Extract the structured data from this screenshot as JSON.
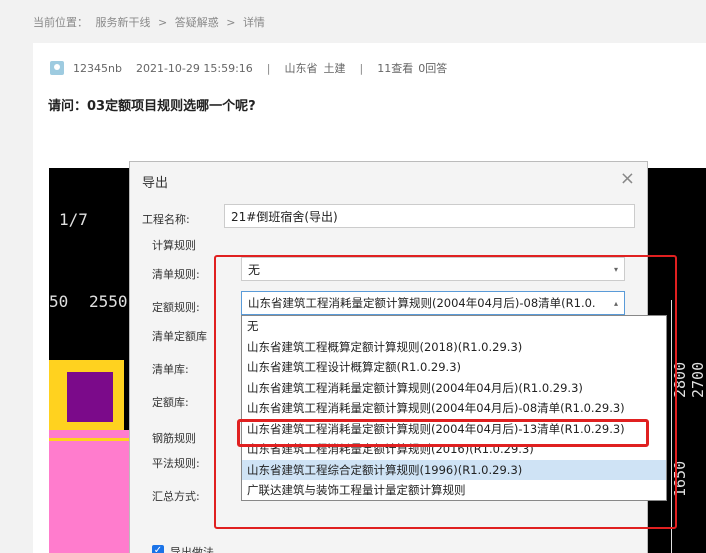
{
  "breadcrumb": [
    "当前位置：",
    "服务新干线",
    ">",
    "答疑解惑",
    ">",
    "详情"
  ],
  "post": {
    "user": "12345nb",
    "datetime": "2021-10-29 15:59:16",
    "sep": "|",
    "region": "山东省",
    "category": "土建",
    "views": "11查看",
    "answers": "0回答",
    "question": "请问：03定额项目规则选哪一个呢?"
  },
  "cad": {
    "label_scale": "1/7",
    "label_50": "50",
    "label_2550": "2550",
    "label_2800": "2800",
    "label_1650": "1650",
    "label_2700": "2700"
  },
  "dialog": {
    "title": "导出",
    "close": "×",
    "project_name_label": "工程名称:",
    "project_name_value": "21#倒班宿舍(导出)",
    "calc_rules_group": "计算规则",
    "list_rule_label": "清单规则:",
    "list_rule_value": "无",
    "quota_rule_label": "定额规则:",
    "quota_rule_value": "山东省建筑工程消耗量定额计算规则(2004年04月后)-08清单(R1.0.",
    "list_quota_group": "清单定额库",
    "list_lib_label": "清单库:",
    "quota_lib_label": "定额库:",
    "rebar_group": "钢筋规则",
    "flat_rule_label": "平法规则:",
    "summary_label": "汇总方式:",
    "export_checkbox": "导出做法",
    "dropdown_options": [
      "无",
      "山东省建筑工程概算定额计算规则(2018)(R1.0.29.3)",
      "山东省建筑工程设计概算定额(R1.0.29.3)",
      "山东省建筑工程消耗量定额计算规则(2004年04月后)(R1.0.29.3)",
      "山东省建筑工程消耗量定额计算规则(2004年04月后)-08清单(R1.0.29.3)",
      "山东省建筑工程消耗量定额计算规则(2004年04月后)-13清单(R1.0.29.3)",
      "山东省建筑工程消耗量定额计算规则(2016)(R1.0.29.3)",
      "山东省建筑工程综合定额计算规则(1996)(R1.0.29.3)",
      "广联达建筑与装饰工程量计量定额计算规则"
    ]
  },
  "colors": {
    "accent_red": "#e02020",
    "selected_bg": "#cfe3f5",
    "cad_bg": "#000000"
  }
}
